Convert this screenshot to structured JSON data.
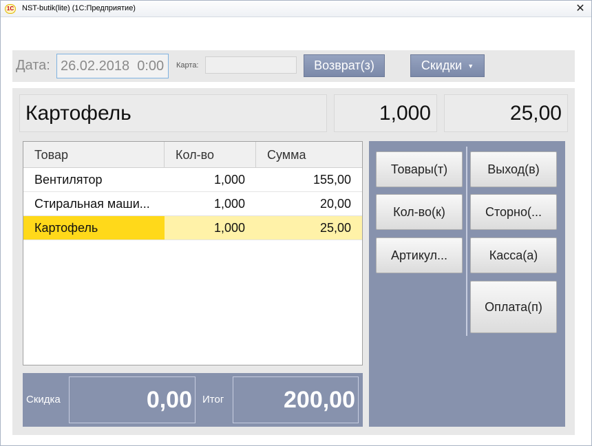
{
  "window": {
    "app_logo": "1С",
    "title": "NST-butik(lite)  (1С:Предприятие)",
    "close_glyph": "✕"
  },
  "header": {
    "date_label": "Дата:",
    "date_value": "26.02.2018  0:00",
    "card_label": "Карта:",
    "card_value": "",
    "return_button": "Возврат(з)",
    "discounts_button": "Скидки",
    "discounts_caret": "▼"
  },
  "current_item": {
    "name": "Картофель",
    "qty": "1,000",
    "sum": "25,00"
  },
  "table": {
    "columns": [
      "Товар",
      "Кол-во",
      "Сумма"
    ],
    "rows": [
      {
        "product": "Вентилятор",
        "qty": "1,000",
        "sum": "155,00"
      },
      {
        "product": "Стиральная маши...",
        "qty": "1,000",
        "sum": "20,00"
      },
      {
        "product": "Картофель",
        "qty": "1,000",
        "sum": "25,00",
        "selected": true
      }
    ]
  },
  "totals": {
    "discount_label": "Скидка",
    "discount_value": "0,00",
    "total_label": "Итог",
    "total_value": "200,00"
  },
  "actions": {
    "goods": "Товары(т)",
    "quantity": "Кол-во(к)",
    "article": "Артикул...",
    "exit": "Выход(в)",
    "storno": "Сторно(...",
    "cash": "Касса(а)",
    "payment": "Оплата(п)"
  },
  "colors": {
    "panel_gray": "#e8e8e8",
    "slate_blue": "#8792ad",
    "selected_yellow": "#ffd91a",
    "selected_light_yellow": "#fff2a8",
    "date_focus_border": "#7fb2e0"
  }
}
